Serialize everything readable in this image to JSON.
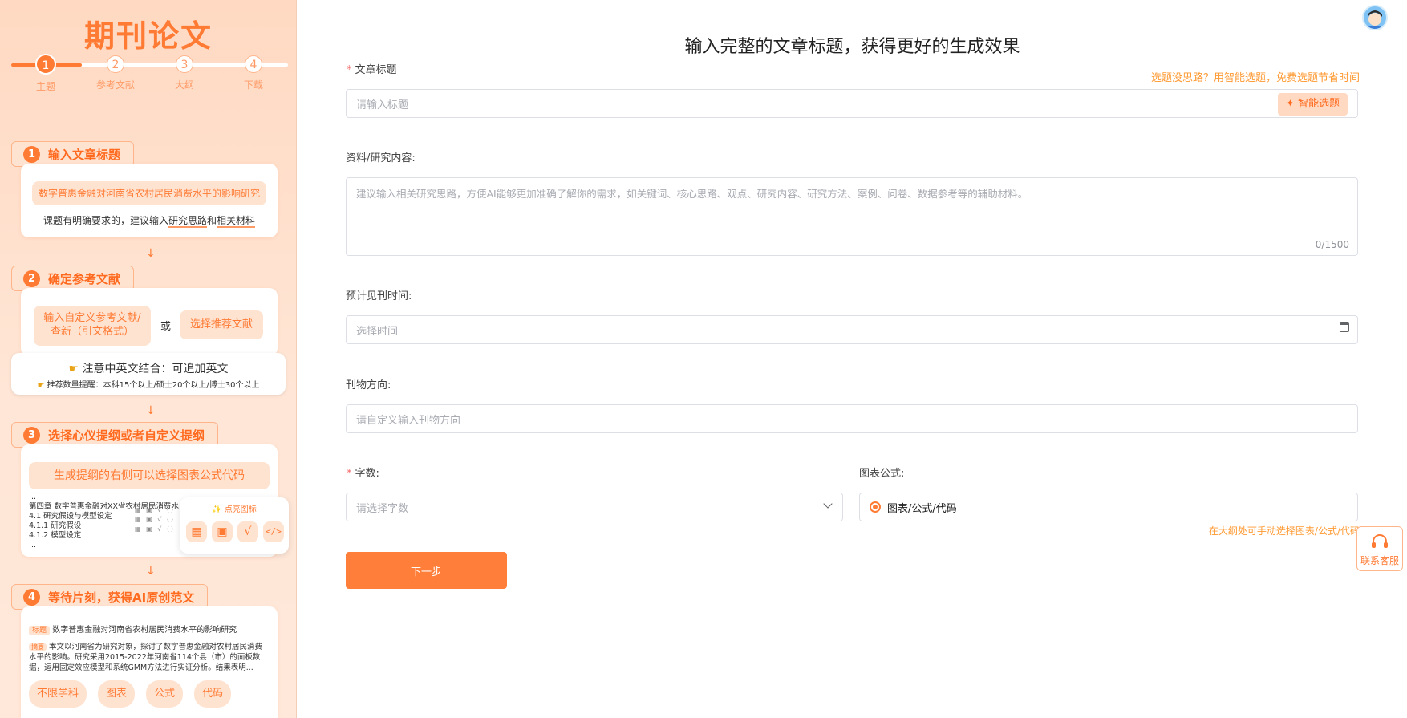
{
  "sidebar": {
    "title": "期刊论文",
    "steps": [
      {
        "num": "1",
        "label": "主题"
      },
      {
        "num": "2",
        "label": "参考文献"
      },
      {
        "num": "3",
        "label": "大纲"
      },
      {
        "num": "4",
        "label": "下载"
      }
    ],
    "sec1": {
      "num": "1",
      "title": "输入文章标题",
      "example": "数字普惠金融对河南省农村居民消费水平的影响研究",
      "tip_prefix": "课题有明确要求的，建议输入",
      "tip_a": "研究思路",
      "tip_and": "和",
      "tip_b": "相关材料"
    },
    "sec2": {
      "num": "2",
      "title": "确定参考文献",
      "btn_custom": "输入自定义参考文献/查新（引文格式）",
      "or": "或",
      "btn_recommend": "选择推荐文献",
      "note_main": "注意中英文结合：可追加英文",
      "note_sub": "推荐数量提醒：本科15个以上/硕士20个以上/博士30个以上"
    },
    "sec3": {
      "num": "3",
      "title": "选择心仪提纲或者自定义提纲",
      "pill": "生成提纲的右侧可以选择图表公式代码",
      "lines": [
        "...",
        "第四章 数字普惠金融对XX省农村居民消费水",
        "4.1 研究假设与模型设定",
        "4.1.1 研究假设",
        "4.1.2 模型设定",
        "..."
      ],
      "popup_title": "点亮图标"
    },
    "sec4": {
      "num": "4",
      "title": "等待片刻，获得AI原创范文",
      "tag_title": "标题",
      "paper_title": "数字普惠金融对河南省农村居民消费水平的影响研究",
      "tag_abstract": "摘要",
      "abstract": "本文以河南省为研究对象，探讨了数字普惠金融对农村居民消费水平的影响。研究采用2015-2022年河南省114个县（市）的面板数据，运用固定效应模型和系统GMM方法进行实证分析。结果表明...",
      "chips": [
        "不限学科",
        "图表",
        "公式",
        "代码"
      ]
    }
  },
  "main": {
    "headline": "输入完整的文章标题，获得更好的生成效果",
    "title_label": "文章标题",
    "title_hint": "选题没思路？用智能选题，免费选题节省时间",
    "title_placeholder": "请输入标题",
    "smart_btn": "智能选题",
    "content_label": "资料/研究内容:",
    "content_placeholder": "建议输入相关研究思路，方便AI能够更加准确了解你的需求，如关键词、核心思路、观点、研究内容、研究方法、案例、问卷、数据参考等的辅助材料。",
    "content_count": "0/1500",
    "date_label": "预计见刊时间:",
    "date_placeholder": "选择时间",
    "direction_label": "刊物方向:",
    "direction_placeholder": "请自定义输入刊物方向",
    "words_label": "字数:",
    "words_placeholder": "请选择字数",
    "formula_label": "图表公式:",
    "formula_option": "图表/公式/代码",
    "formula_hint": "在大纲处可手动选择图表/公式/代码",
    "next_btn": "下一步",
    "service_label": "联系客服"
  },
  "colors": {
    "accent": "#ff7a33",
    "sidebar_bg": "#ffe3d1",
    "hint": "#ff9a33",
    "required": "#f56c6c"
  }
}
